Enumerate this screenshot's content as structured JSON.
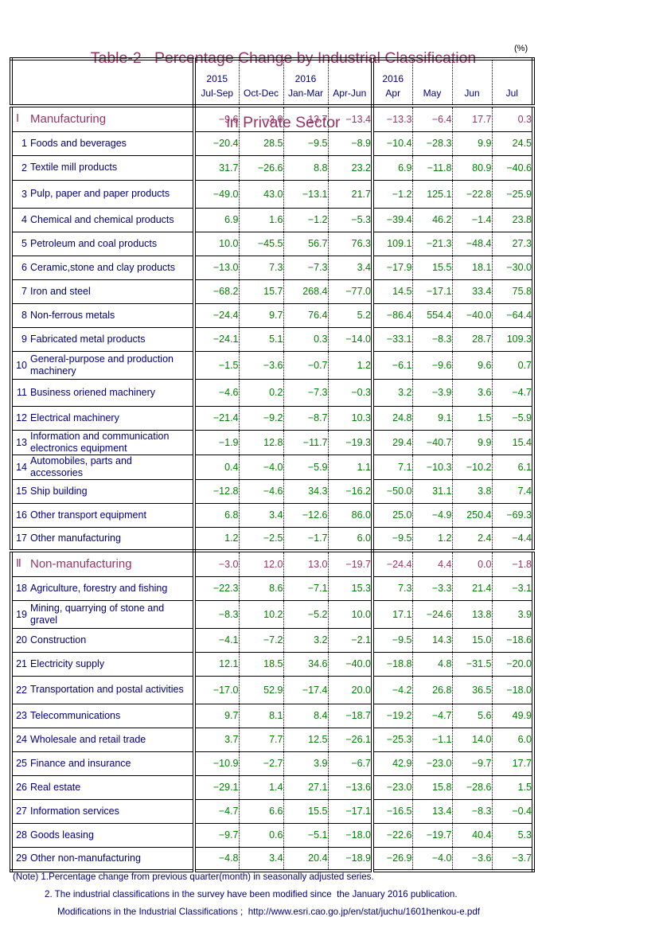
{
  "colors": {
    "title": "#993366",
    "label": "#000080",
    "value": "#008000",
    "section": "#993366"
  },
  "chart_data": {
    "type": "table",
    "title": "Table-2   Percentage Change by Industrial Classification",
    "subtitle": "in Private Sector",
    "unit": "(%)",
    "columns": [
      {
        "year": "2015",
        "label": "Jul-Sep"
      },
      {
        "year": "",
        "label": "Oct-Dec"
      },
      {
        "year": "2016",
        "label": "Jan-Mar"
      },
      {
        "year": "",
        "label": "Apr-Jun"
      },
      {
        "year": "2016",
        "label": "Apr"
      },
      {
        "year": "",
        "label": "May"
      },
      {
        "year": "",
        "label": "Jun"
      },
      {
        "year": "",
        "label": "Jul"
      }
    ],
    "rows": [
      {
        "num": "Ⅰ",
        "label": "Manufacturing",
        "section": true,
        "values": [
          -9.6,
          -3.0,
          13.7,
          -13.4,
          -13.3,
          -6.4,
          17.7,
          0.3
        ]
      },
      {
        "num": "1",
        "label": "Foods and beverages",
        "values": [
          -20.4,
          28.5,
          -9.5,
          -8.9,
          -10.4,
          -28.3,
          9.9,
          24.5
        ]
      },
      {
        "num": "2",
        "label": "Textile mill products",
        "values": [
          31.7,
          -26.6,
          8.8,
          23.2,
          6.9,
          -11.8,
          80.9,
          -40.6
        ]
      },
      {
        "num": "3",
        "label": "Pulp, paper and paper products",
        "values": [
          -49.0,
          43.0,
          -13.1,
          21.7,
          -1.2,
          125.1,
          -22.8,
          -25.9
        ]
      },
      {
        "num": "4",
        "label": "Chemical and chemical products",
        "values": [
          6.9,
          1.6,
          -1.2,
          -5.3,
          -39.4,
          46.2,
          -1.4,
          23.8
        ]
      },
      {
        "num": "5",
        "label": "Petroleum and coal products",
        "values": [
          10.0,
          -45.5,
          56.7,
          76.3,
          109.1,
          -21.3,
          -48.4,
          27.3
        ]
      },
      {
        "num": "6",
        "label": "Ceramic,stone and clay products",
        "values": [
          -13.0,
          7.3,
          -7.3,
          3.4,
          -17.9,
          15.5,
          18.1,
          -30.0
        ]
      },
      {
        "num": "7",
        "label": "Iron and steel",
        "values": [
          -68.2,
          15.7,
          268.4,
          -77.0,
          14.5,
          -17.1,
          33.4,
          75.8
        ]
      },
      {
        "num": "8",
        "label": "Non-ferrous metals",
        "values": [
          -24.4,
          9.7,
          76.4,
          5.2,
          -86.4,
          554.4,
          -40.0,
          -64.4
        ]
      },
      {
        "num": "9",
        "label": "Fabricated metal products",
        "values": [
          -24.1,
          5.1,
          0.3,
          -14.0,
          -33.1,
          -8.3,
          28.7,
          109.3
        ]
      },
      {
        "num": "10",
        "label": "General-purpose and production\nmachinery",
        "values": [
          -1.5,
          -3.6,
          -0.7,
          1.2,
          -6.1,
          -9.6,
          9.6,
          0.7
        ]
      },
      {
        "num": "11",
        "label": "Business oriened machinery",
        "values": [
          -4.6,
          0.2,
          -7.3,
          -0.3,
          3.2,
          -3.9,
          3.6,
          -4.7
        ]
      },
      {
        "num": "12",
        "label": "Electrical machinery",
        "values": [
          -21.4,
          -9.2,
          -8.7,
          10.3,
          24.8,
          9.1,
          1.5,
          -5.9
        ]
      },
      {
        "num": "13",
        "label": "Information and communication\nelectronics equipment",
        "values": [
          -1.9,
          12.8,
          -11.7,
          -19.3,
          29.4,
          -40.7,
          9.9,
          15.4
        ]
      },
      {
        "num": "14",
        "label": "Automobiles, parts and\naccessories",
        "values": [
          0.4,
          -4.0,
          -5.9,
          1.1,
          7.1,
          -10.3,
          -10.2,
          6.1
        ]
      },
      {
        "num": "15",
        "label": "Ship building",
        "values": [
          -12.8,
          -4.6,
          34.3,
          -16.2,
          -50.0,
          31.1,
          3.8,
          7.4
        ]
      },
      {
        "num": "16",
        "label": "Other transport equipment",
        "values": [
          6.8,
          3.4,
          -12.6,
          86.0,
          25.0,
          -4.9,
          250.4,
          -69.3
        ]
      },
      {
        "num": "17",
        "label": "Other manufacturing",
        "values": [
          1.2,
          -2.5,
          -1.7,
          6.0,
          -9.5,
          1.2,
          2.4,
          -4.4
        ]
      },
      {
        "num": "Ⅱ",
        "label": "Non-manufacturing",
        "section": true,
        "values": [
          -3.0,
          12.0,
          13.0,
          -19.7,
          -24.4,
          4.4,
          0.0,
          -1.8
        ]
      },
      {
        "num": "18",
        "label": "Agriculture, forestry and fishing",
        "values": [
          -22.3,
          8.6,
          -7.1,
          15.3,
          7.3,
          -3.3,
          21.4,
          -3.1
        ]
      },
      {
        "num": "19",
        "label": "Mining, quarrying of stone and\ngravel",
        "values": [
          -8.3,
          10.2,
          -5.2,
          10.0,
          17.1,
          -24.6,
          13.8,
          3.9
        ]
      },
      {
        "num": "20",
        "label": "Construction",
        "values": [
          -4.1,
          -7.2,
          3.2,
          -2.1,
          -9.5,
          14.3,
          15.0,
          -18.6
        ]
      },
      {
        "num": "21",
        "label": "Electricity supply",
        "values": [
          12.1,
          18.5,
          34.6,
          -40.0,
          -18.8,
          4.8,
          -31.5,
          -20.0
        ]
      },
      {
        "num": "22",
        "label": "Transportation and postal activities",
        "values": [
          -17.0,
          52.9,
          -17.4,
          20.0,
          -4.2,
          26.8,
          36.5,
          -18.0
        ]
      },
      {
        "num": "23",
        "label": "Telecommunications",
        "values": [
          9.7,
          8.1,
          8.4,
          -18.7,
          -19.2,
          -4.7,
          5.6,
          49.9
        ]
      },
      {
        "num": "24",
        "label": "Wholesale and retail trade",
        "values": [
          3.7,
          7.7,
          12.5,
          -26.1,
          -25.3,
          -1.1,
          14.0,
          6.0
        ]
      },
      {
        "num": "25",
        "label": "Finance and insurance",
        "values": [
          -10.9,
          -2.7,
          3.9,
          -6.7,
          42.9,
          -23.0,
          -9.7,
          17.7
        ]
      },
      {
        "num": "26",
        "label": "Real estate",
        "values": [
          -29.1,
          1.4,
          27.1,
          -13.6,
          -23.0,
          15.8,
          -28.6,
          1.5
        ]
      },
      {
        "num": "27",
        "label": "Information services",
        "values": [
          -4.7,
          6.6,
          15.5,
          -17.1,
          -16.5,
          13.4,
          -8.3,
          -0.4
        ]
      },
      {
        "num": "28",
        "label": "Goods leasing",
        "values": [
          -9.7,
          0.6,
          -5.1,
          -18.0,
          -22.6,
          -19.7,
          40.4,
          5.3
        ]
      },
      {
        "num": "29",
        "label": "Other non-manufacturing",
        "values": [
          -4.8,
          3.4,
          20.4,
          -18.9,
          -26.9,
          -4.0,
          -3.6,
          -3.7
        ]
      }
    ]
  },
  "notes": [
    "(Note) 1.Percentage change from previous quarter(month) in seasonally adjusted series.",
    "2. The industrial classifications in the survey have been modified since  the January 2016 publication.",
    "Modifications in the Industrial Classifications ;  http://www.esri.cao.go.jp/en/stat/juchu/1601henkou-e.pdf"
  ]
}
